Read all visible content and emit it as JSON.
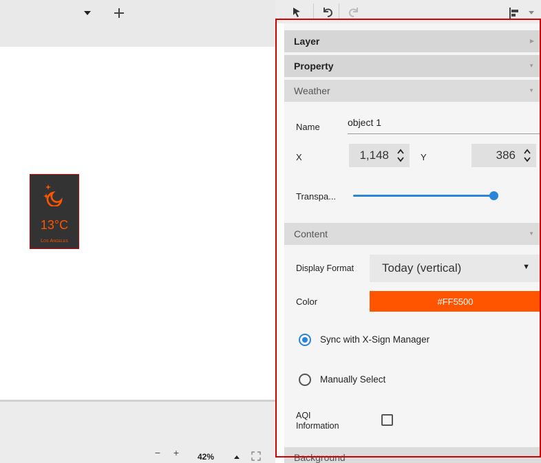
{
  "toolbar": {
    "dropdown_icon": "caret-down-icon",
    "add_icon": "plus-icon",
    "pointer_icon": "cursor-arrow-icon",
    "undo_icon": "undo-icon",
    "redo_icon": "redo-icon",
    "align_icon": "align-left-icon"
  },
  "widget": {
    "icon": "moon-stars-icon",
    "temperature": "13°C",
    "city": "Los Angeles",
    "accent_color": "#FF5500"
  },
  "panel": {
    "sections": {
      "layer": "Layer",
      "property": "Property",
      "weather": "Weather",
      "content": "Content",
      "background": "Background"
    },
    "name_label": "Name",
    "name_value": "object 1",
    "x_label": "X",
    "x_value": "1,148",
    "y_label": "Y",
    "y_value": "386",
    "transparency_label": "Transpa...",
    "transparency_value": 1.0,
    "display_format_label": "Display Format",
    "display_format_value": "Today (vertical)",
    "color_label": "Color",
    "color_value": "#FF5500",
    "radio_sync_label": "Sync with X-Sign Manager",
    "radio_manual_label": "Manually Select",
    "radio_selected": "sync",
    "aqi_label_line1": "AQI",
    "aqi_label_line2": "Information",
    "aqi_checked": false
  },
  "statusbar": {
    "zoom_out": "−",
    "zoom_in": "+",
    "zoom_level": "42%",
    "zoom_up_icon": "triangle-up-icon",
    "fit_icon": "fit-screen-icon"
  }
}
